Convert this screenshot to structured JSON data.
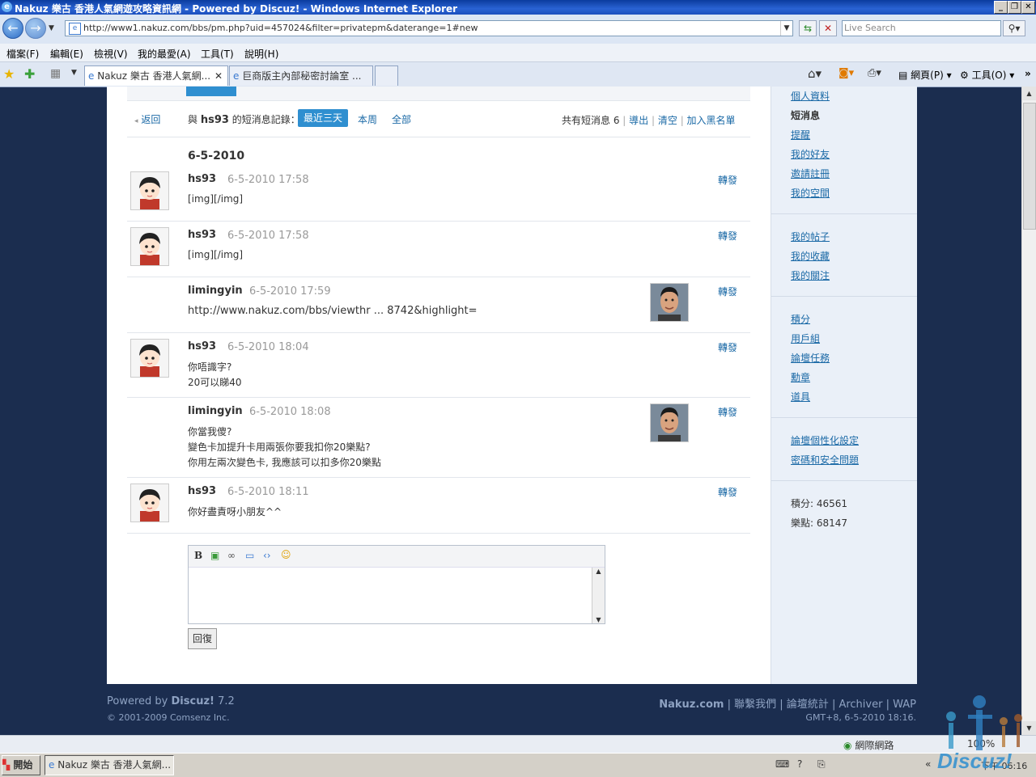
{
  "window": {
    "title": "Nakuz 樂古 香港人氣網遊攻略資訊網 - Powered by Discuz! - Windows Internet Explorer",
    "url": "http://www1.nakuz.com/bbs/pm.php?uid=457024&filter=privatepm&daterange=1#new",
    "search_placeholder": "Live Search"
  },
  "menu": [
    "檔案(F)",
    "編輯(E)",
    "檢視(V)",
    "我的最愛(A)",
    "工具(T)",
    "說明(H)"
  ],
  "tabs": [
    {
      "label": "Nakuz 樂古 香港人氣網...",
      "active": true
    },
    {
      "label": "巨商版主內部秘密討論室 ...",
      "active": false
    }
  ],
  "toolbar": {
    "page_label": "網頁(P)",
    "tools_label": "工具(O)"
  },
  "pm": {
    "back_label": "返回",
    "title_prefix": "與",
    "title_user": "hs93",
    "title_suffix": "的短消息記錄：",
    "filters": [
      "最近三天",
      "本周",
      "全部"
    ],
    "total_label": "共有短消息 6",
    "actions": [
      "導出",
      "清空",
      "加入黑名單"
    ],
    "date_header": "6-5-2010",
    "forward_label": "轉發",
    "reply_button": "回復",
    "messages": [
      {
        "author": "hs93",
        "time": "6-5-2010 17:58",
        "lines": [
          "[img][/img]"
        ],
        "side": "left"
      },
      {
        "author": "hs93",
        "time": "6-5-2010 17:58",
        "lines": [
          "[img][/img]"
        ],
        "side": "left"
      },
      {
        "author": "limingyin",
        "time": "6-5-2010 17:59",
        "lines": [
          "http://www.nakuz.com/bbs/viewthr ... 8742&highlight="
        ],
        "side": "right",
        "is_link": true
      },
      {
        "author": "hs93",
        "time": "6-5-2010 18:04",
        "lines": [
          "你唔識字?",
          "20可以睇40"
        ],
        "side": "left"
      },
      {
        "author": "limingyin",
        "time": "6-5-2010 18:08",
        "lines": [
          "你當我傻?",
          "變色卡加提升卡用兩張你要我扣你20樂點?",
          "你用左兩次變色卡, 我應該可以扣多你20樂點"
        ],
        "side": "right"
      },
      {
        "author": "hs93",
        "time": "6-5-2010 18:11",
        "lines": [
          "你好盡責呀小朋友^^"
        ],
        "side": "left"
      }
    ]
  },
  "sidebar": {
    "group1": [
      "個人資料",
      "短消息",
      "提醒",
      "我的好友",
      "邀請註冊",
      "我的空間"
    ],
    "group2": [
      "我的帖子",
      "我的收藏",
      "我的關注"
    ],
    "group3": [
      "積分",
      "用戶組",
      "論壇任務",
      "勳章",
      "道具"
    ],
    "group4": [
      "論壇個性化設定",
      "密碼和安全問題"
    ],
    "stats": [
      "積分: 46561",
      "樂點: 68147"
    ]
  },
  "footer": {
    "powered_prefix": "Powered by",
    "powered_brand": "Discuz!",
    "powered_version": "7.2",
    "copyright": "© 2001-2009 Comsenz Inc.",
    "site": "Nakuz.com",
    "links": [
      "聯繫我們",
      "論壇統計",
      "Archiver",
      "WAP"
    ],
    "time": "GMT+8, 6-5-2010 18:16."
  },
  "status": {
    "zone": "網際網路",
    "zoom": "100%"
  },
  "taskbar": {
    "start": "開始",
    "task": "Nakuz 樂古 香港人氣網...",
    "clock": "下午 06:16"
  },
  "watermark": "Discuz!"
}
